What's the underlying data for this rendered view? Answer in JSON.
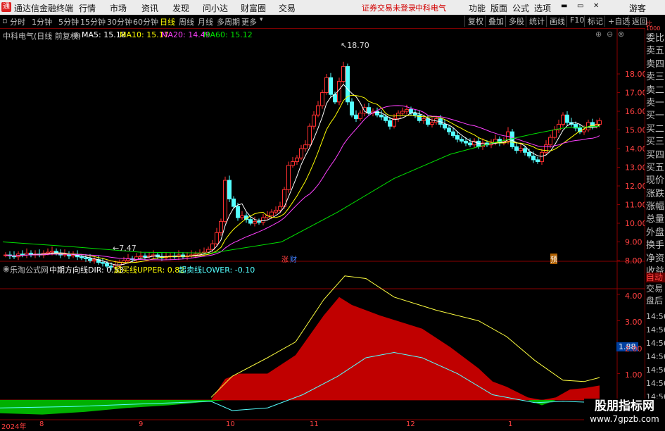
{
  "menu": {
    "app_title": "通达信金融终端",
    "items": [
      "行情",
      "市场",
      "资讯",
      "发现",
      "问小达",
      "财富圈",
      "交易"
    ],
    "login_status": "证券交易未登录",
    "stock_name": "中科电气",
    "right_items": [
      "功能",
      "版面",
      "公式",
      "选项"
    ],
    "user": "游客"
  },
  "toolbar": {
    "periods": [
      "分时",
      "1分钟",
      "5分钟",
      "15分钟",
      "30分钟",
      "60分钟",
      "日线",
      "周线",
      "月线",
      "多周期",
      "更多"
    ],
    "active_period": "日线",
    "right_buttons": [
      "复权",
      "叠加",
      "多股",
      "统计",
      "画线",
      "F10",
      "标记",
      "+自选",
      "返回"
    ]
  },
  "main_chart": {
    "title": "中科电气(日线 前复权)",
    "ma5": "MA5: 15.18",
    "ma10": "MA10: 15.17",
    "ma20": "MA20: 14.49",
    "ma60": "MA60: 15.12",
    "high_label": "18.70",
    "low_label": "7.47",
    "price_ticks": [
      "18.00",
      "17.00",
      "16.00",
      "15.00",
      "14.00",
      "13.00",
      "12.00",
      "11.00",
      "10.00",
      "9.00",
      "8.00"
    ],
    "marker_zhang": "涨",
    "marker_cai": "财",
    "marker_yu": "预",
    "colors": {
      "ma5": "#ffffff",
      "ma10": "#ffff00",
      "ma20": "#ff40ff",
      "ma60": "#00e000",
      "up": "#ff3030",
      "down": "#54ffff"
    }
  },
  "indicator": {
    "name": "乐淘公式网",
    "dir": "中期方向线DIR: 0.53",
    "upper": "超买线UPPER: 0.82",
    "lower": "超卖线LOWER: -0.10",
    "ticks": [
      "4.00",
      "3.00",
      "2.00",
      "1.00"
    ],
    "current_value": "1.88"
  },
  "x_axis": [
    "2024年",
    "8",
    "9",
    "10",
    "11",
    "12",
    "1"
  ],
  "side_panel": {
    "labels": [
      "委比",
      "卖五",
      "卖四",
      "卖三",
      "卖二",
      "卖一",
      "买一",
      "买二",
      "买三",
      "买四",
      "买五",
      "现价",
      "涨跌",
      "涨幅",
      "总量",
      "外盘",
      "换手",
      "净资",
      "收益"
    ],
    "auto_label": "自动",
    "trade_label": "交易",
    "after_hours": "盘后",
    "times": [
      "14:56",
      "14:56",
      "14:56",
      "14:56",
      "14:56",
      "14:56",
      "14:56"
    ],
    "ratio_top": "比",
    "ratio_val": "1000"
  },
  "watermark": {
    "line1": "股朋指标网",
    "line2": "www.7gpzb.com"
  }
}
